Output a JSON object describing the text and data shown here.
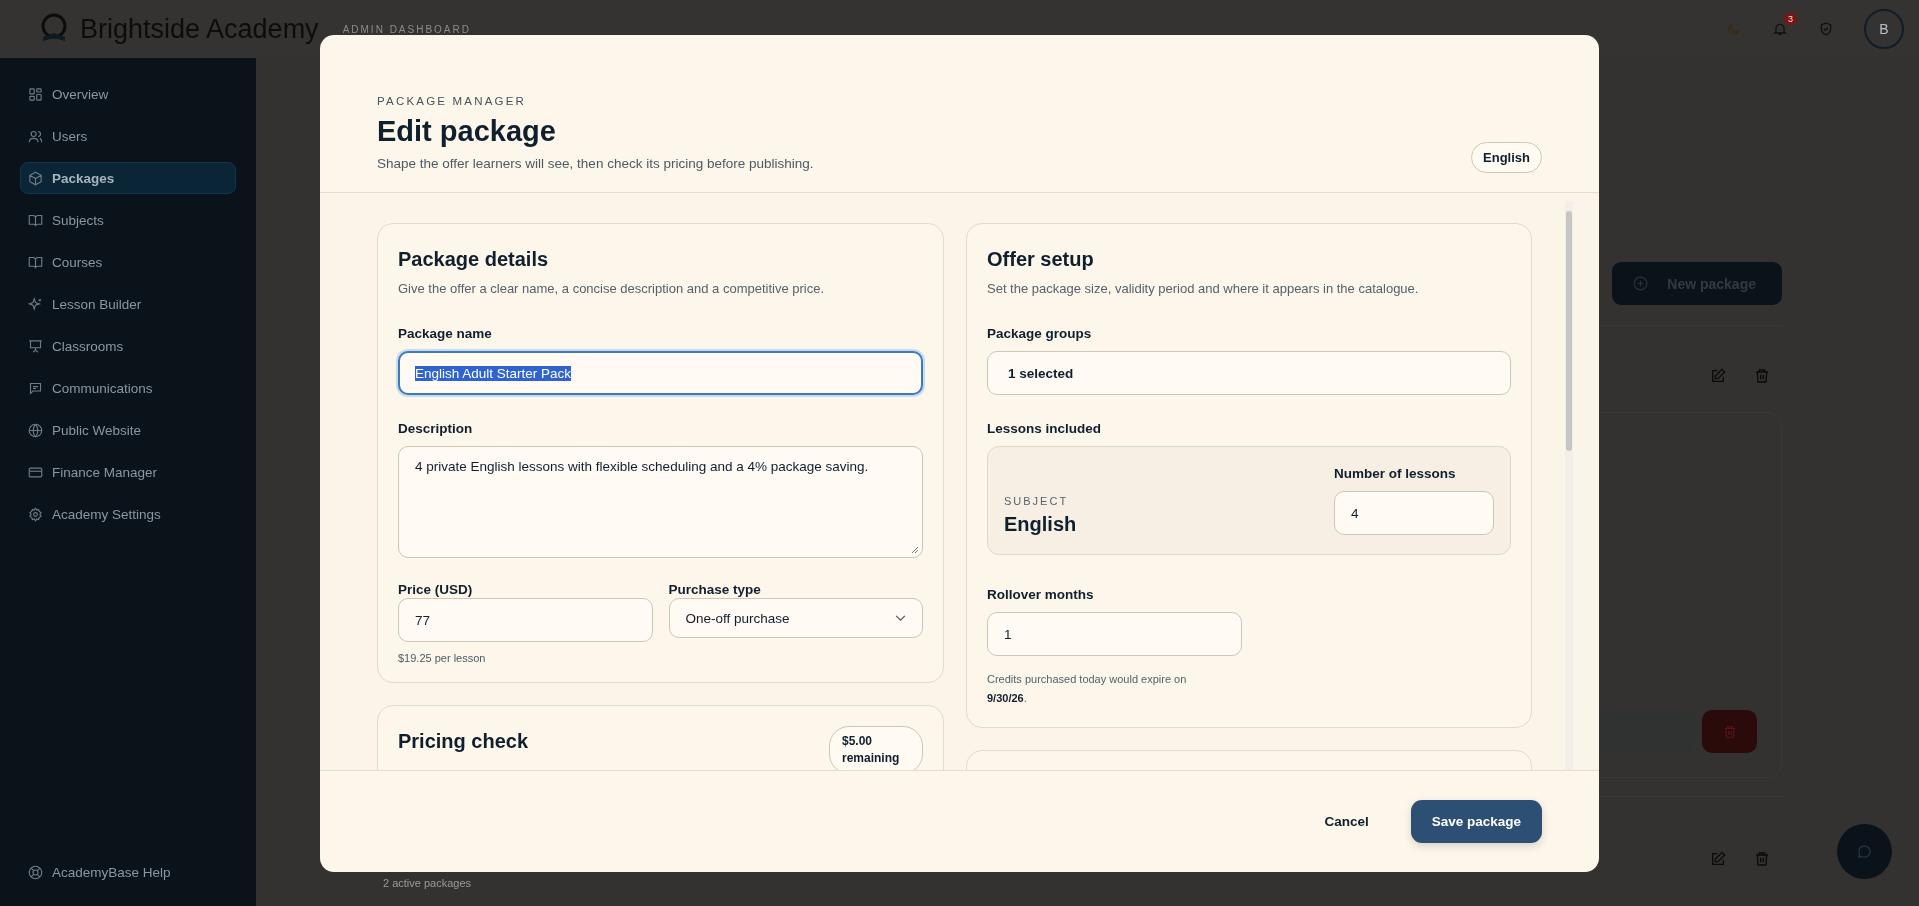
{
  "app": {
    "name": "Brightside Academy",
    "section": "ADMIN DASHBOARD"
  },
  "header": {
    "notification_count": "3",
    "avatar_initial": "B"
  },
  "sidebar": {
    "items": [
      {
        "label": "Overview",
        "selected": false
      },
      {
        "label": "Users",
        "selected": false
      },
      {
        "label": "Packages",
        "selected": true
      },
      {
        "label": "Subjects",
        "selected": false
      },
      {
        "label": "Courses",
        "selected": false
      },
      {
        "label": "Lesson Builder",
        "selected": false
      },
      {
        "label": "Classrooms",
        "selected": false
      },
      {
        "label": "Communications",
        "selected": false
      },
      {
        "label": "Public Website",
        "selected": false
      },
      {
        "label": "Finance Manager",
        "selected": false
      },
      {
        "label": "Academy Settings",
        "selected": false
      }
    ],
    "help": "AcademyBase Help"
  },
  "page": {
    "new_package_button": "New package",
    "footer_count": "2 active packages"
  },
  "modal": {
    "eyebrow": "PACKAGE MANAGER",
    "title": "Edit package",
    "subtitle": "Shape the offer learners will see, then check its pricing before publishing.",
    "language": "English",
    "package_details": {
      "title": "Package details",
      "subtitle": "Give the offer a clear name, a concise description and a competitive price.",
      "name_label": "Package name",
      "name_value": "English Adult Starter Pack",
      "name_selected": true,
      "description_label": "Description",
      "description_value": "4 private English lessons with flexible scheduling and a 4% package saving.",
      "price_label": "Price (USD)",
      "price_value": "77",
      "price_hint": "$19.25 per lesson",
      "purchase_type_label": "Purchase type",
      "purchase_type_value": "One-off purchase"
    },
    "pricing_check": {
      "title": "Pricing check",
      "badge": "$5.00 remaining"
    },
    "offer_setup": {
      "title": "Offer setup",
      "subtitle": "Set the package size, validity period and where it appears in the catalogue.",
      "groups_label": "Package groups",
      "groups_value": "1 selected",
      "lessons_label": "Lessons included",
      "subject_label": "SUBJECT",
      "subject": "English",
      "number_label": "Number of lessons",
      "number_value": "4",
      "rollover_label": "Rollover months",
      "rollover_value": "1",
      "expiry_note": "Credits purchased today would expire on **9/30/26**."
    },
    "footer": {
      "cancel": "Cancel",
      "save": "Save package"
    }
  }
}
